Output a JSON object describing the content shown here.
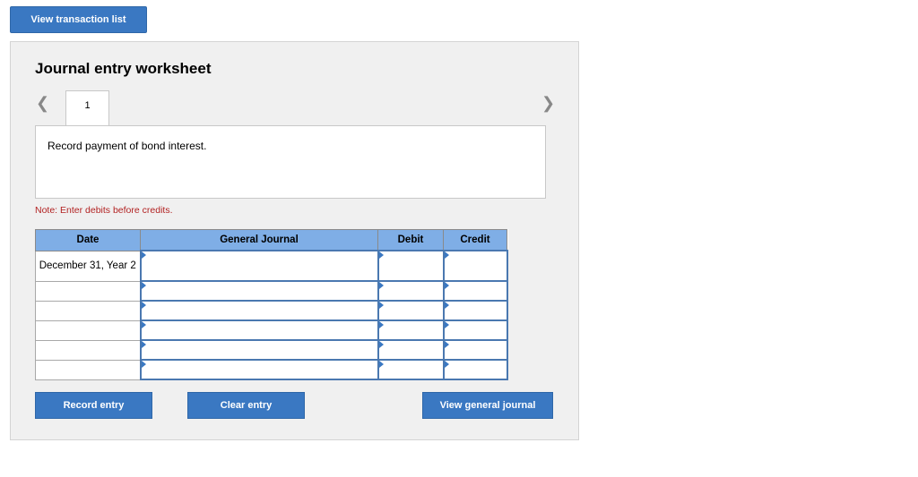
{
  "top_button": "View transaction list",
  "worksheet": {
    "title": "Journal entry worksheet",
    "prev_icon": "chevron-left-icon",
    "next_icon": "chevron-right-icon",
    "active_tab": "1",
    "description": "Record payment of bond interest.",
    "note": "Note: Enter debits before credits."
  },
  "table": {
    "headers": [
      "Date",
      "General Journal",
      "Debit",
      "Credit"
    ],
    "rows": [
      {
        "date": "December 31, Year 2",
        "account": "",
        "debit": "",
        "credit": ""
      },
      {
        "date": "",
        "account": "",
        "debit": "",
        "credit": ""
      },
      {
        "date": "",
        "account": "",
        "debit": "",
        "credit": ""
      },
      {
        "date": "",
        "account": "",
        "debit": "",
        "credit": ""
      },
      {
        "date": "",
        "account": "",
        "debit": "",
        "credit": ""
      },
      {
        "date": "",
        "account": "",
        "debit": "",
        "credit": ""
      }
    ]
  },
  "buttons": {
    "record": "Record entry",
    "clear": "Clear entry",
    "view_journal": "View general journal"
  }
}
